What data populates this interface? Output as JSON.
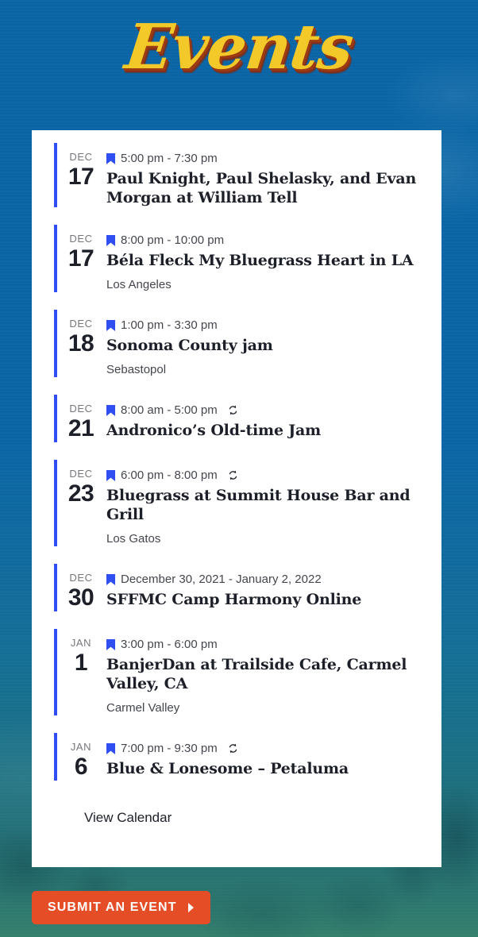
{
  "page": {
    "title": "Events",
    "background_color": "#0b66a6",
    "accent_color": "#2f4ff2",
    "title_color": "#f2c928",
    "title_shadow_color": "#9c3a12"
  },
  "events": [
    {
      "month": "DEC",
      "day": "17",
      "time": "5:00 pm - 7:30 pm",
      "title": "Paul Knight, Paul Shelasky, and Evan Morgan at William Tell",
      "venue": "",
      "recurring": false
    },
    {
      "month": "DEC",
      "day": "17",
      "time": "8:00 pm - 10:00 pm",
      "title": "Béla Fleck My Bluegrass Heart in LA",
      "venue": "Los Angeles",
      "recurring": false
    },
    {
      "month": "DEC",
      "day": "18",
      "time": "1:00 pm - 3:30 pm",
      "title": "Sonoma County jam",
      "venue": "Sebastopol",
      "recurring": false
    },
    {
      "month": "DEC",
      "day": "21",
      "time": "8:00 am - 5:00 pm",
      "title": "Andronico’s Old-time Jam",
      "venue": "",
      "recurring": true
    },
    {
      "month": "DEC",
      "day": "23",
      "time": "6:00 pm - 8:00 pm",
      "title": "Bluegrass at Summit House Bar and Grill",
      "venue": "Los Gatos",
      "recurring": true
    },
    {
      "month": "DEC",
      "day": "30",
      "time": "December 30, 2021 - January 2, 2022",
      "title": "SFFMC Camp Harmony Online",
      "venue": "",
      "recurring": false
    },
    {
      "month": "JAN",
      "day": "1",
      "time": "3:00 pm - 6:00 pm",
      "title": "BanjerDan at Trailside Cafe, Carmel Valley, CA",
      "venue": "Carmel Valley",
      "recurring": false
    },
    {
      "month": "JAN",
      "day": "6",
      "time": "7:00 pm - 9:30 pm",
      "title": "Blue & Lonesome – Petaluma",
      "venue": "",
      "recurring": true
    }
  ],
  "footer": {
    "view_calendar_label": "View Calendar"
  },
  "submit": {
    "label": "Submit an Event",
    "button_color": "#e44d26",
    "arrow_icon": "arrow-right-icon"
  },
  "icons": {
    "bookmark": "bookmark-icon",
    "repeat": "repeat-icon"
  }
}
